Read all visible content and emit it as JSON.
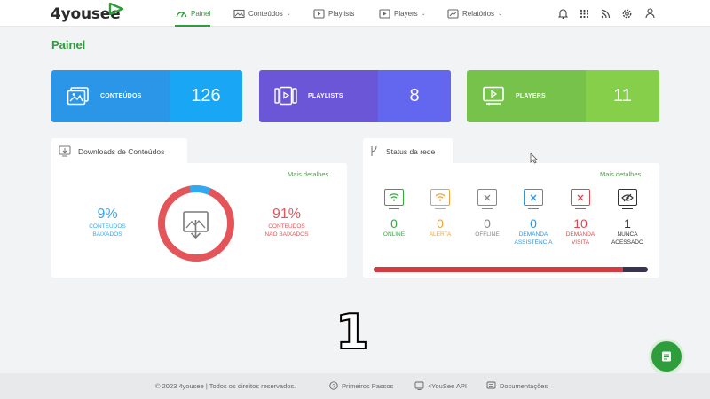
{
  "app": {
    "logo_text": "4yousee"
  },
  "nav": {
    "items": [
      {
        "label": "Painel",
        "icon": "gauge-icon",
        "active": true
      },
      {
        "label": "Conteúdos",
        "icon": "images-icon",
        "caret": "⌄"
      },
      {
        "label": "Playlists",
        "icon": "playlist-icon"
      },
      {
        "label": "Players",
        "icon": "player-icon",
        "caret": "⌄"
      },
      {
        "label": "Relatórios",
        "icon": "chart-icon",
        "caret": "⌄"
      }
    ],
    "right_icons": [
      "bell-icon",
      "apps-grid-icon",
      "rss-icon",
      "gear-icon",
      "user-icon"
    ]
  },
  "page": {
    "title": "Painel"
  },
  "stats": [
    {
      "label": "CONTEÚDOS",
      "value": "126",
      "icon": "images-icon"
    },
    {
      "label": "PLAYLISTS",
      "value": "8",
      "icon": "playlist-icon"
    },
    {
      "label": "PLAYERS",
      "value": "11",
      "icon": "player-icon"
    }
  ],
  "downloads": {
    "title": "Downloads de Conteúdos",
    "more": "Mais detalhes",
    "done_pct_label": "9%",
    "done_line1": "CONTEÚDOS",
    "done_line2": "BAIXADOS",
    "pending_pct_label": "91%",
    "pending_line1": "CONTEÚDOS",
    "pending_line2": "NÃO BAIXADOS",
    "done_fraction": 0.09,
    "colors": {
      "done": "#32a9ee",
      "pending": "#e4555a"
    }
  },
  "network": {
    "title": "Status da rede",
    "more": "Mais detalhes",
    "items": [
      {
        "value": "0",
        "label1": "ONLINE",
        "label2": "",
        "color": "#33a93d",
        "icon": "wifi-monitor-icon"
      },
      {
        "value": "0",
        "label1": "ALERTA",
        "label2": "",
        "color": "#f0a33a",
        "icon": "wifi-monitor-icon"
      },
      {
        "value": "0",
        "label1": "OFFLINE",
        "label2": "",
        "color": "#888888",
        "icon": "x-monitor-icon"
      },
      {
        "value": "0",
        "label1": "DEMANDA",
        "label2": "ASSISTÊNCIA",
        "color": "#2b95e8",
        "icon": "x-monitor-icon"
      },
      {
        "value": "10",
        "label1": "DEMANDA",
        "label2": "VISITA",
        "color": "#e0474c",
        "icon": "x-monitor-icon"
      },
      {
        "value": "1",
        "label1": "NUNCA",
        "label2": "ACESSADO",
        "color": "#333333",
        "icon": "hidden-eye-monitor-icon"
      }
    ],
    "bar_red_fraction": 0.909
  },
  "footer": {
    "copyright": "© 2023 4yousee | Todos os direitos reservados.",
    "links": [
      {
        "label": "Primeiros Passos",
        "icon": "help-icon"
      },
      {
        "label": "4YouSee API",
        "icon": "api-icon"
      },
      {
        "label": "Documentações",
        "icon": "docs-icon"
      }
    ]
  },
  "overlay_number": "1"
}
